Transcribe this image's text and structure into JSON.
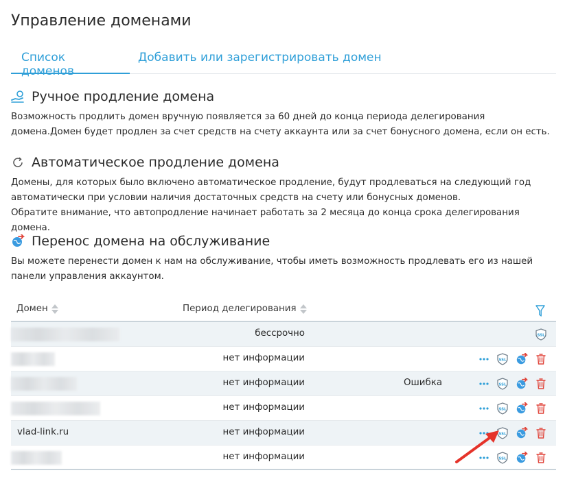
{
  "page": {
    "title": "Управление доменами"
  },
  "tabs": [
    {
      "label": "Список доменов",
      "active": true
    },
    {
      "label": "Добавить или зарегистрировать домен",
      "active": false
    }
  ],
  "sections": {
    "manual": {
      "title": "Ручное продление домена",
      "icon": "hand-coin-icon",
      "text": "Возможность продлить домен вручную появляется за 60 дней до конца периода делегирования домена.Домен будет продлен за счет средств на счету аккаунта или за счет бонусного домена, если он есть."
    },
    "auto": {
      "title": "Автоматическое продление домена",
      "icon": "refresh-icon",
      "text1": "Домены, для которых было включено автоматическое продление, будут продлеваться на следующий год автоматически при условии наличия достаточных средств на счету или бонусных доменов.",
      "text2": "Обратите внимание, что автопродление начинает работать за 2 месяца до конца срока делегирования домена."
    },
    "transfer": {
      "title": "Перенос домена на обслуживание",
      "icon": "globe-arrow-icon",
      "text": "Вы можете перенести домен к нам на обслуживание, чтобы иметь возможность продлевать его из нашей панели управления аккаунтом."
    }
  },
  "table": {
    "headers": {
      "domain": "Домен",
      "period": "Период делегирования"
    },
    "rows": [
      {
        "domain": "",
        "period": "бессрочно",
        "status": ""
      },
      {
        "domain": "",
        "period": "нет информации",
        "status": ""
      },
      {
        "domain": "",
        "period": "нет информации",
        "status": "Ошибка"
      },
      {
        "domain": "",
        "period": "нет информации",
        "status": ""
      },
      {
        "domain": "vlad-link.ru",
        "period": "нет информации",
        "status": ""
      },
      {
        "domain": "",
        "period": "нет информации",
        "status": ""
      }
    ]
  },
  "icons": {
    "ssl_label": "SSL",
    "more": "more-dots-icon",
    "ssl": "ssl-shield-icon",
    "transfer": "globe-arrow-icon",
    "delete": "trash-icon",
    "filter": "filter-icon"
  },
  "colors": {
    "accent": "#2f9fd8",
    "delete": "#e0443a",
    "arrow": "#e5332a"
  }
}
